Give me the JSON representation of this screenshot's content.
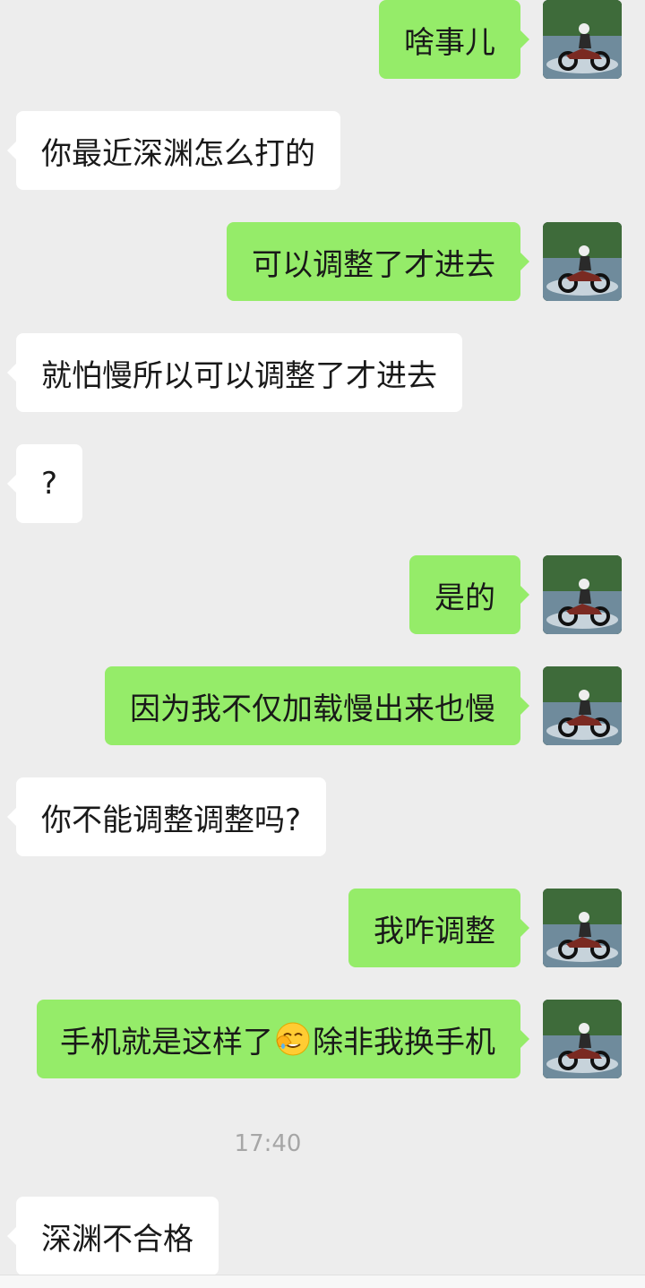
{
  "chat": {
    "messages": [
      {
        "side": "right",
        "text": "啥事儿"
      },
      {
        "side": "left",
        "text": "你最近深渊怎么打的"
      },
      {
        "side": "right",
        "text": "可以调整了才进去"
      },
      {
        "side": "left",
        "text": "就怕慢所以可以调整了才进去"
      },
      {
        "side": "left",
        "text": "?"
      },
      {
        "side": "right",
        "text": "是的"
      },
      {
        "side": "right",
        "text": "因为我不仅加载慢出来也慢"
      },
      {
        "side": "left",
        "text": "你不能调整调整吗?"
      },
      {
        "side": "right",
        "text": "我咋调整"
      },
      {
        "side": "right",
        "text_before": "手机就是这样了",
        "emoji": "facepalm-emoji",
        "text_after": "除非我换手机"
      },
      {
        "side": "left",
        "text": "深渊不合格"
      }
    ],
    "timestamp": "17:40"
  },
  "avatar_icon": "motorcycle-rider-avatar",
  "colors": {
    "background": "#ededed",
    "sent_bubble": "#95ec69",
    "received_bubble": "#ffffff",
    "timestamp": "#a6a6a6"
  }
}
